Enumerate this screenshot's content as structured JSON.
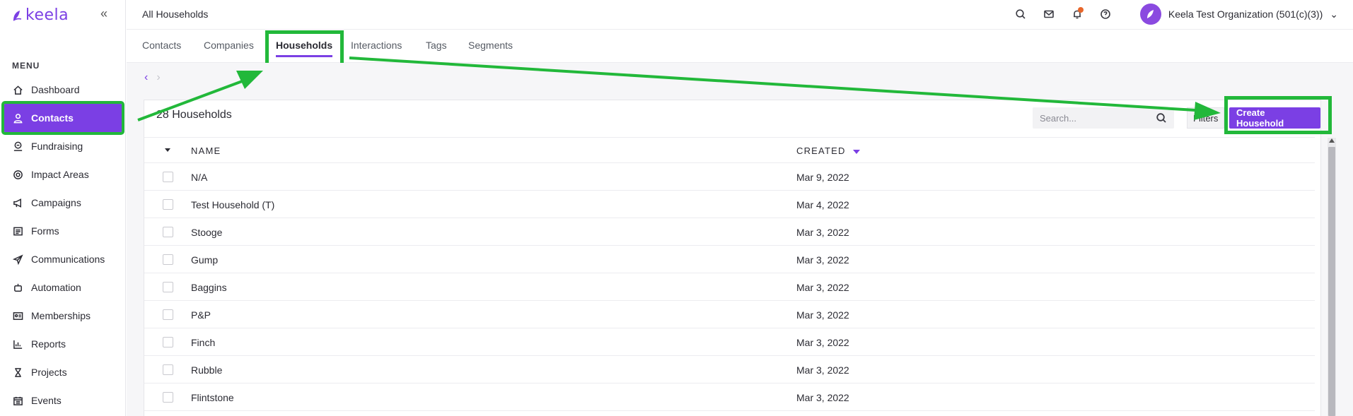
{
  "brand": {
    "name": "keela",
    "accent": "#7b3fe4",
    "annotation_color": "#22b83a"
  },
  "sidebar": {
    "menu_label": "MENU",
    "items": [
      {
        "label": "Dashboard",
        "icon": "home-icon"
      },
      {
        "label": "Contacts",
        "icon": "person-icon",
        "active": true
      },
      {
        "label": "Fundraising",
        "icon": "donation-icon"
      },
      {
        "label": "Impact Areas",
        "icon": "target-icon"
      },
      {
        "label": "Campaigns",
        "icon": "megaphone-icon"
      },
      {
        "label": "Forms",
        "icon": "form-icon"
      },
      {
        "label": "Communications",
        "icon": "send-icon"
      },
      {
        "label": "Automation",
        "icon": "robot-icon"
      },
      {
        "label": "Memberships",
        "icon": "id-card-icon"
      },
      {
        "label": "Reports",
        "icon": "bar-chart-icon"
      },
      {
        "label": "Projects",
        "icon": "hourglass-icon"
      },
      {
        "label": "Events",
        "icon": "calendar-icon"
      }
    ]
  },
  "header": {
    "title": "All Households",
    "org_name": "Keela Test Organization (501(c)(3))"
  },
  "tabs": [
    {
      "label": "Contacts"
    },
    {
      "label": "Companies"
    },
    {
      "label": "Households",
      "active": true
    },
    {
      "label": "Interactions"
    },
    {
      "label": "Tags"
    },
    {
      "label": "Segments"
    }
  ],
  "list": {
    "count_label": "28 Households",
    "search_placeholder": "Search...",
    "filters_label": "Filters",
    "create_label": "Create Household",
    "columns": {
      "name": "NAME",
      "created": "CREATED"
    },
    "rows": [
      {
        "name": "N/A",
        "created": "Mar 9, 2022"
      },
      {
        "name": "Test Household (T)",
        "created": "Mar 4, 2022"
      },
      {
        "name": "Stooge",
        "created": "Mar 3, 2022"
      },
      {
        "name": "Gump",
        "created": "Mar 3, 2022"
      },
      {
        "name": "Baggins",
        "created": "Mar 3, 2022"
      },
      {
        "name": "P&P",
        "created": "Mar 3, 2022"
      },
      {
        "name": "Finch",
        "created": "Mar 3, 2022"
      },
      {
        "name": "Rubble",
        "created": "Mar 3, 2022"
      },
      {
        "name": "Flintstone",
        "created": "Mar 3, 2022"
      }
    ]
  }
}
